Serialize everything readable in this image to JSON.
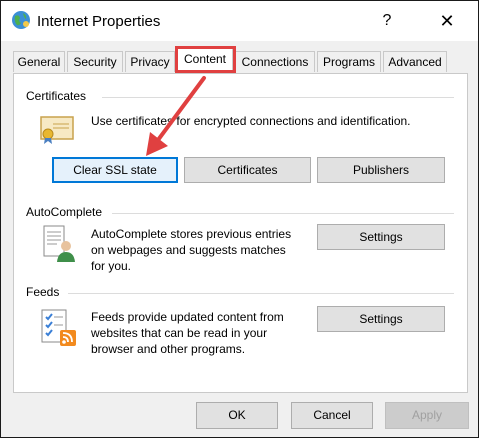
{
  "window": {
    "title": "Internet Properties",
    "help_glyph": "?",
    "close_glyph": "✕"
  },
  "tabs": [
    {
      "label": "General"
    },
    {
      "label": "Security"
    },
    {
      "label": "Privacy"
    },
    {
      "label": "Content",
      "active": true
    },
    {
      "label": "Connections"
    },
    {
      "label": "Programs"
    },
    {
      "label": "Advanced"
    }
  ],
  "certificates": {
    "group_label": "Certificates",
    "description": "Use certificates for encrypted connections and identification.",
    "buttons": {
      "clear_ssl": "Clear SSL state",
      "certificates": "Certificates",
      "publishers": "Publishers"
    }
  },
  "autocomplete": {
    "group_label": "AutoComplete",
    "description_lines": [
      "AutoComplete stores previous entries",
      "on webpages and suggests matches",
      "for you."
    ],
    "settings_label": "Settings"
  },
  "feeds": {
    "group_label": "Feeds",
    "description_lines": [
      "Feeds provide updated content from",
      "websites that can be read in your",
      "browser and other programs."
    ],
    "settings_label": "Settings"
  },
  "footer": {
    "ok": "OK",
    "cancel": "Cancel",
    "apply": "Apply"
  },
  "colors": {
    "annotation": "#e04040",
    "focus": "#0078d7"
  }
}
